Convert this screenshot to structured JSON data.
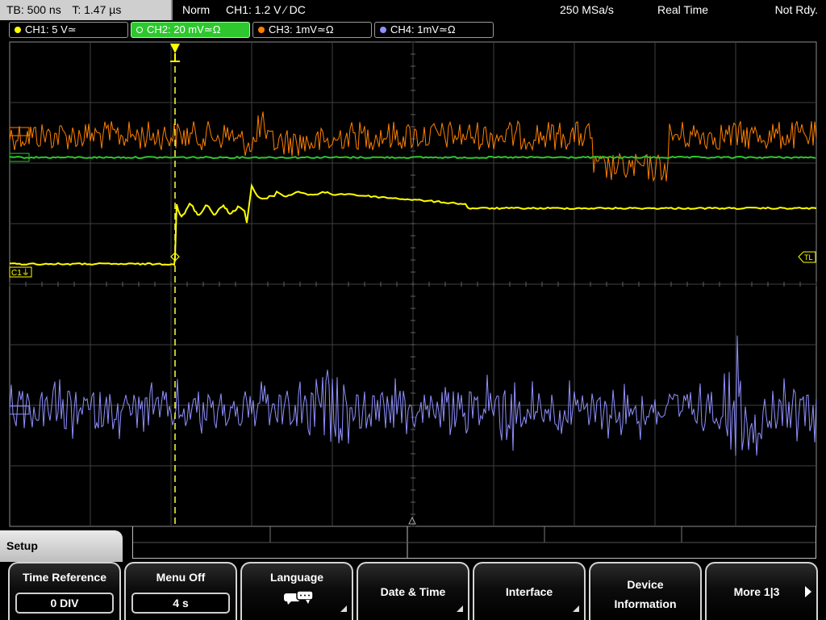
{
  "status": {
    "timebase": "TB: 500 ns",
    "trigger_time": "T: 1.47 µs",
    "trigger_mode": "Norm",
    "trigger_info": "CH1: 1.2 V ⁄ DC",
    "sample_rate": "250 MSa/s",
    "acq_mode": "Real Time",
    "trigger_status": "Not Rdy."
  },
  "channels": [
    {
      "label": "CH1: 5 V≃",
      "color": "#ffff00"
    },
    {
      "label": "CH2: 20 mV≃Ω",
      "color": "#2ec82e"
    },
    {
      "label": "CH3: 1mV≃Ω",
      "color": "#ff8000"
    },
    {
      "label": "CH4: 1mV≃Ω",
      "color": "#9090ff"
    }
  ],
  "markers": {
    "ch1_ground": "C1⏚",
    "trigger_level": "TL"
  },
  "menu": {
    "title": "Setup",
    "softkeys": [
      {
        "label": "Time Reference",
        "value": "0 DIV"
      },
      {
        "label": "Menu Off",
        "value": "4 s"
      },
      {
        "label": "Language",
        "icon": "speech-bubbles-icon"
      },
      {
        "label": "Date & Time"
      },
      {
        "label": "Interface"
      },
      {
        "label": "Device Information"
      },
      {
        "label": "More 1|3"
      }
    ]
  },
  "colors": {
    "grid": "#505050",
    "trigger_line": "#ffff40",
    "ch1_trace": "#ffff00",
    "ch2_trace": "#2ec82e",
    "ch3_trace": "#ff8000",
    "ch4_trace": "#9090ff"
  }
}
